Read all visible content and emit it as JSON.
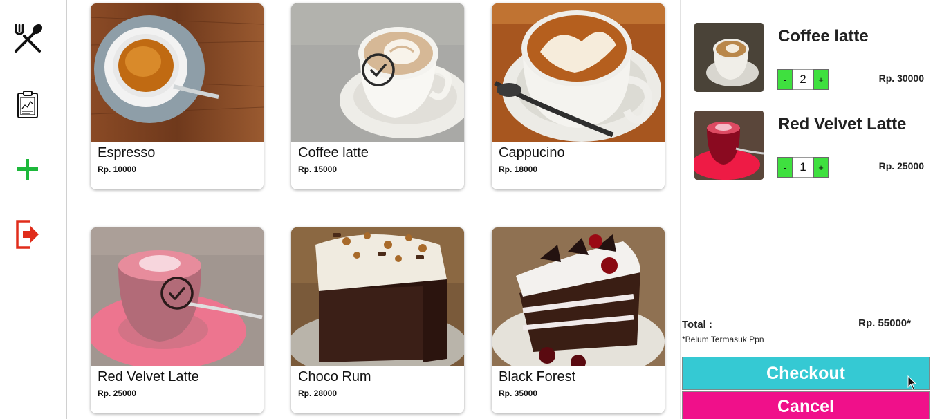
{
  "sidebar": {
    "items": [
      {
        "icon": "fork-spoon-icon",
        "label": "Menu"
      },
      {
        "icon": "clipboard-report-icon",
        "label": "Reports"
      },
      {
        "icon": "plus-icon",
        "label": "Add"
      },
      {
        "icon": "logout-icon",
        "label": "Logout"
      }
    ]
  },
  "menu": {
    "items": [
      {
        "name": "Espresso",
        "price": "Rp. 10000",
        "selected": false
      },
      {
        "name": "Coffee latte",
        "price": "Rp. 15000",
        "selected": true
      },
      {
        "name": "Cappucino",
        "price": "Rp. 18000",
        "selected": false
      },
      {
        "name": "Red Velvet Latte",
        "price": "Rp. 25000",
        "selected": true
      },
      {
        "name": "Choco Rum",
        "price": "Rp. 28000",
        "selected": false
      },
      {
        "name": "Black Forest",
        "price": "Rp. 35000",
        "selected": false
      }
    ]
  },
  "cart": {
    "items": [
      {
        "name": "Coffee latte",
        "qty": "2",
        "price": "Rp. 30000"
      },
      {
        "name": "Red Velvet Latte",
        "qty": "1",
        "price": "Rp. 25000"
      }
    ],
    "minus_label": "-",
    "plus_label": "+",
    "total_label": "Total :",
    "total_value": "Rp. 55000*",
    "tax_note": "*Belum Termasuk Ppn",
    "checkout_label": "Checkout",
    "cancel_label": "Cancel"
  },
  "colors": {
    "accent_checkout": "#35c9d3",
    "accent_cancel": "#f0108a",
    "qty_button": "#3fe03f",
    "add_icon": "#1db83b",
    "logout_icon": "#e02d1b"
  }
}
